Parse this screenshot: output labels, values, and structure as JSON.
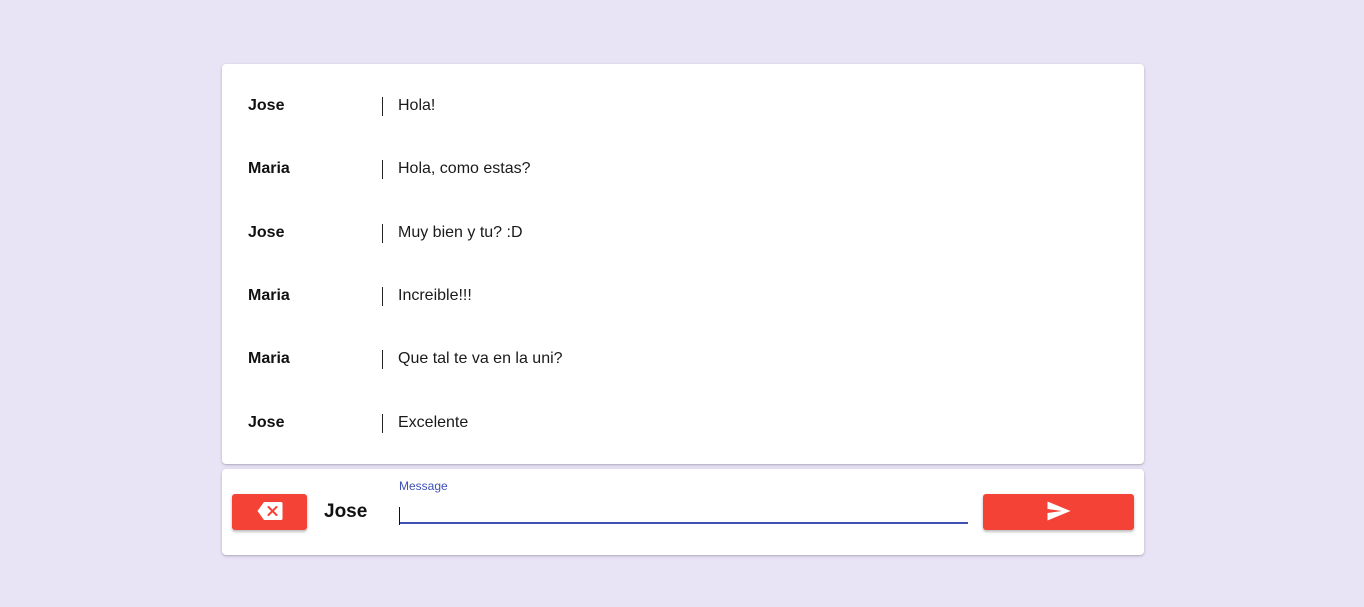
{
  "messages": [
    {
      "author": "Jose",
      "text": "Hola!"
    },
    {
      "author": "Maria",
      "text": "Hola, como estas?"
    },
    {
      "author": "Jose",
      "text": "Muy bien y tu? :D"
    },
    {
      "author": "Maria",
      "text": "Increible!!!"
    },
    {
      "author": "Maria",
      "text": "Que tal te va en la uni?"
    },
    {
      "author": "Jose",
      "text": "Excelente"
    }
  ],
  "composer": {
    "current_user": "Jose",
    "message_label": "Message",
    "message_value": "",
    "clear_icon": "backspace-icon",
    "send_icon": "send-icon"
  },
  "colors": {
    "background": "#e8e4f6",
    "accent": "#f44336",
    "primary": "#3f51b5"
  }
}
